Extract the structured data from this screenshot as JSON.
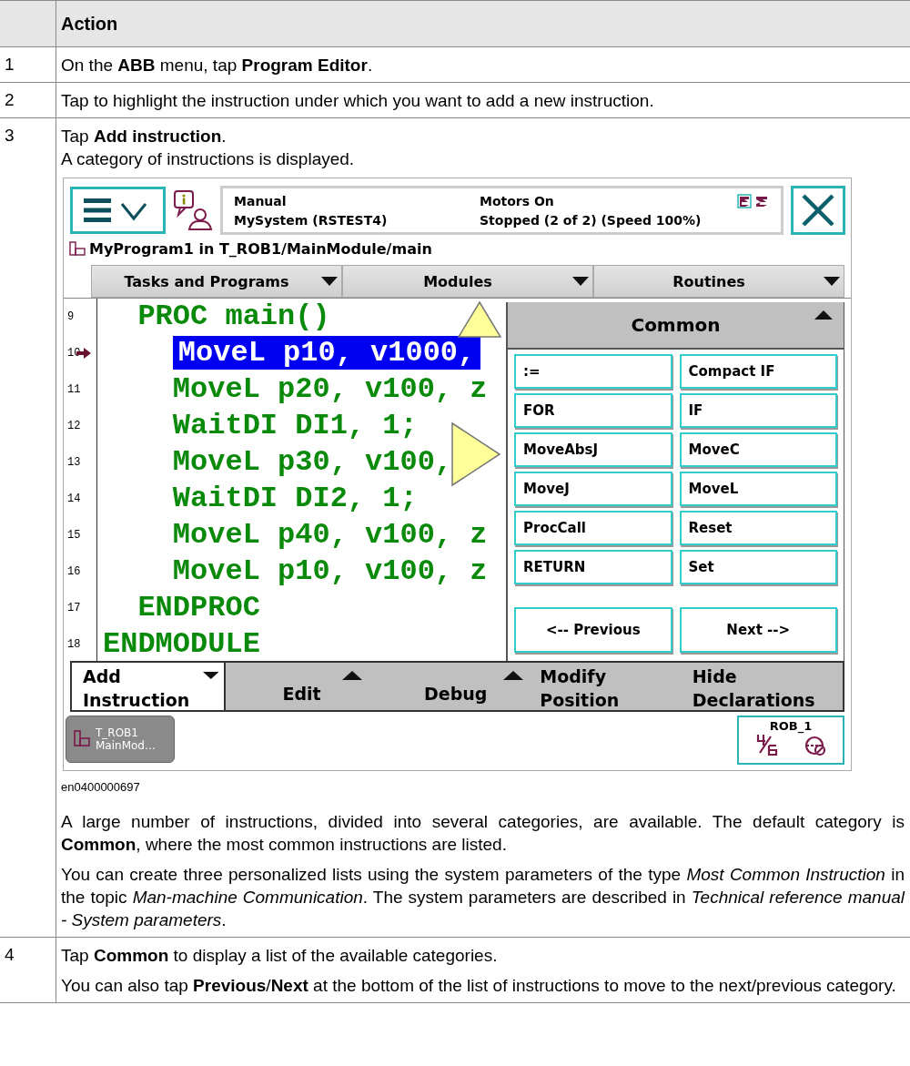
{
  "table": {
    "header": "Action",
    "steps": [
      {
        "number": "1",
        "paragraphs": [
          "On the **ABB** menu, tap **Program Editor**."
        ]
      },
      {
        "number": "2",
        "paragraphs": [
          "Tap to highlight the instruction under which you want to add a new instruction."
        ]
      },
      {
        "number": "3",
        "paragraphs": [
          "Tap **Add instruction**.\nA category of instructions is displayed."
        ],
        "caption": "en0400000697",
        "after": [
          "A large number of instructions, divided into several categories, are available. The default category is **Common**, where the most common instructions are listed.",
          "You can create three personalized lists using the system parameters of the type *Most Common Instruction* in the topic *Man-machine Communication*. The system parameters are described in *Technical reference manual - System parameters*."
        ]
      },
      {
        "number": "4",
        "paragraphs": [
          "Tap **Common** to display a list of the available categories.",
          "You can also tap **Previous**/**Next** at the bottom of the list of instructions to move to the next/previous category."
        ]
      }
    ]
  },
  "pendant": {
    "status": {
      "mode": "Manual",
      "system": "MySystem (RSTEST4)",
      "motors": "Motors On",
      "state": "Stopped (2 of 2) (Speed 100%)"
    },
    "program_path": "MyProgram1 in T_ROB1/MainModule/main",
    "dropdowns": [
      "Tasks and Programs",
      "Modules",
      "Routines"
    ],
    "code_lines": [
      {
        "number": "9",
        "text": "  PROC main()",
        "selected": false,
        "pointer": false
      },
      {
        "number": "10",
        "text": "    MoveL p10, v1000,",
        "selected": true,
        "pointer": true
      },
      {
        "number": "11",
        "text": "    MoveL p20, v100, z",
        "selected": false,
        "pointer": false
      },
      {
        "number": "12",
        "text": "    WaitDI DI1, 1;",
        "selected": false,
        "pointer": false
      },
      {
        "number": "13",
        "text": "    MoveL p30, v100,",
        "selected": false,
        "pointer": false
      },
      {
        "number": "14",
        "text": "    WaitDI DI2, 1;",
        "selected": false,
        "pointer": false
      },
      {
        "number": "15",
        "text": "    MoveL p40, v100, z",
        "selected": false,
        "pointer": false
      },
      {
        "number": "16",
        "text": "    MoveL p10, v100, z",
        "selected": false,
        "pointer": false
      },
      {
        "number": "17",
        "text": "  ENDPROC",
        "selected": false,
        "pointer": false
      },
      {
        "number": "18",
        "text": "ENDMODULE",
        "selected": false,
        "pointer": false
      }
    ],
    "category": {
      "title": "Common",
      "instructions": [
        ":=",
        "Compact IF",
        "FOR",
        "IF",
        "MoveAbsJ",
        "MoveC",
        "MoveJ",
        "MoveL",
        "ProcCall",
        "Reset",
        "RETURN",
        "Set"
      ],
      "previous": "<--  Previous",
      "next": "Next  -->"
    },
    "menu": [
      {
        "label": "Add Instruction",
        "selected": true,
        "kind": "dropdown"
      },
      {
        "label": "Edit",
        "selected": false,
        "kind": "popup"
      },
      {
        "label": "Debug",
        "selected": false,
        "kind": "popup"
      },
      {
        "label": "Modify Position",
        "selected": false,
        "kind": "button"
      },
      {
        "label": "Hide Declarations",
        "selected": false,
        "kind": "button"
      }
    ],
    "taskbar": {
      "lines": [
        "T_ROB1",
        "MainMod…"
      ]
    },
    "quickset": {
      "unit": "ROB_1"
    }
  }
}
